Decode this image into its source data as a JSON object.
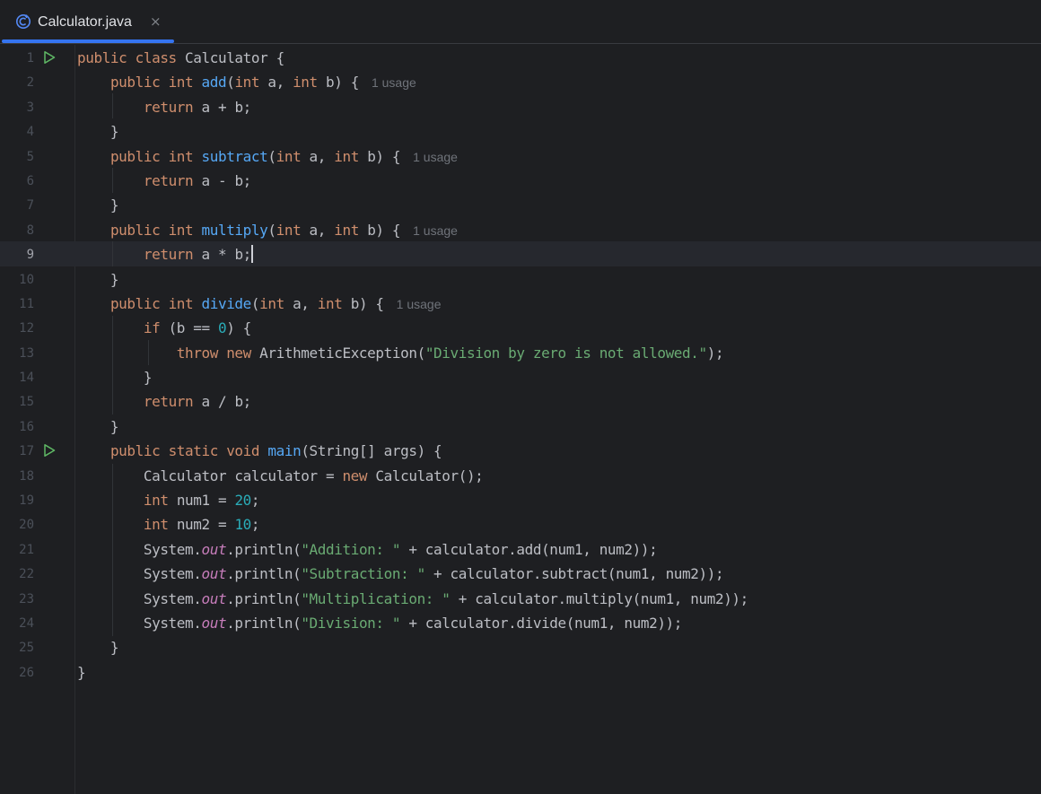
{
  "tab": {
    "label": "Calculator.java",
    "close": "×"
  },
  "editor": {
    "lines": [
      {
        "num": "1",
        "tokens": [
          [
            "kw",
            "public class "
          ],
          [
            "",
            "Calculator {"
          ]
        ]
      },
      {
        "num": "2",
        "tokens": [
          [
            "",
            "    "
          ],
          [
            "kw",
            "public int "
          ],
          [
            "fn",
            "add"
          ],
          [
            "",
            "("
          ],
          [
            "kw",
            "int "
          ],
          [
            "",
            "a, "
          ],
          [
            "kw",
            "int "
          ],
          [
            "",
            "b) {"
          ]
        ],
        "hint": "1 usage"
      },
      {
        "num": "3",
        "tokens": [
          [
            "",
            "        "
          ],
          [
            "kw",
            "return "
          ],
          [
            "",
            "a + b;"
          ]
        ]
      },
      {
        "num": "4",
        "tokens": [
          [
            "",
            "    }"
          ]
        ]
      },
      {
        "num": "5",
        "tokens": [
          [
            "",
            "    "
          ],
          [
            "kw",
            "public int "
          ],
          [
            "fn",
            "subtract"
          ],
          [
            "",
            "("
          ],
          [
            "kw",
            "int "
          ],
          [
            "",
            "a, "
          ],
          [
            "kw",
            "int "
          ],
          [
            "",
            "b) {"
          ]
        ],
        "hint": "1 usage"
      },
      {
        "num": "6",
        "tokens": [
          [
            "",
            "        "
          ],
          [
            "kw",
            "return "
          ],
          [
            "",
            "a - b;"
          ]
        ]
      },
      {
        "num": "7",
        "tokens": [
          [
            "",
            "    }"
          ]
        ]
      },
      {
        "num": "8",
        "tokens": [
          [
            "",
            "    "
          ],
          [
            "kw",
            "public int "
          ],
          [
            "fn",
            "multiply"
          ],
          [
            "",
            "("
          ],
          [
            "kw",
            "int "
          ],
          [
            "",
            "a, "
          ],
          [
            "kw",
            "int "
          ],
          [
            "",
            "b) {"
          ]
        ],
        "hint": "1 usage"
      },
      {
        "num": "9",
        "tokens": [
          [
            "",
            "        "
          ],
          [
            "kw",
            "return "
          ],
          [
            "",
            "a * b;"
          ]
        ],
        "caret": true
      },
      {
        "num": "10",
        "tokens": [
          [
            "",
            "    }"
          ]
        ]
      },
      {
        "num": "11",
        "tokens": [
          [
            "",
            "    "
          ],
          [
            "kw",
            "public int "
          ],
          [
            "fn",
            "divide"
          ],
          [
            "",
            "("
          ],
          [
            "kw",
            "int "
          ],
          [
            "",
            "a, "
          ],
          [
            "kw",
            "int "
          ],
          [
            "",
            "b) {"
          ]
        ],
        "hint": "1 usage"
      },
      {
        "num": "12",
        "tokens": [
          [
            "",
            "        "
          ],
          [
            "kw",
            "if "
          ],
          [
            "",
            "(b == "
          ],
          [
            "num",
            "0"
          ],
          [
            "",
            ") {"
          ]
        ]
      },
      {
        "num": "13",
        "tokens": [
          [
            "",
            "            "
          ],
          [
            "kw",
            "throw new "
          ],
          [
            "",
            "ArithmeticException("
          ],
          [
            "str",
            "\"Division by zero is not allowed.\""
          ],
          [
            "",
            ");"
          ]
        ]
      },
      {
        "num": "14",
        "tokens": [
          [
            "",
            "        }"
          ]
        ]
      },
      {
        "num": "15",
        "tokens": [
          [
            "",
            "        "
          ],
          [
            "kw",
            "return "
          ],
          [
            "",
            "a / b;"
          ]
        ]
      },
      {
        "num": "16",
        "tokens": [
          [
            "",
            "    }"
          ]
        ]
      },
      {
        "num": "17",
        "tokens": [
          [
            "",
            "    "
          ],
          [
            "kw",
            "public static void "
          ],
          [
            "fn",
            "main"
          ],
          [
            "",
            "(String[] args) {"
          ]
        ]
      },
      {
        "num": "18",
        "tokens": [
          [
            "",
            "        Calculator calculator = "
          ],
          [
            "kw",
            "new "
          ],
          [
            "",
            "Calculator();"
          ]
        ]
      },
      {
        "num": "19",
        "tokens": [
          [
            "",
            "        "
          ],
          [
            "kw",
            "int "
          ],
          [
            "",
            "num1 = "
          ],
          [
            "num",
            "20"
          ],
          [
            "",
            ";"
          ]
        ]
      },
      {
        "num": "20",
        "tokens": [
          [
            "",
            "        "
          ],
          [
            "kw",
            "int "
          ],
          [
            "",
            "num2 = "
          ],
          [
            "num",
            "10"
          ],
          [
            "",
            ";"
          ]
        ]
      },
      {
        "num": "21",
        "tokens": [
          [
            "",
            "        System."
          ],
          [
            "stat",
            "out"
          ],
          [
            "",
            ".println("
          ],
          [
            "str",
            "\"Addition: \""
          ],
          [
            "",
            " + calculator.add(num1, num2));"
          ]
        ]
      },
      {
        "num": "22",
        "tokens": [
          [
            "",
            "        System."
          ],
          [
            "stat",
            "out"
          ],
          [
            "",
            ".println("
          ],
          [
            "str",
            "\"Subtraction: \""
          ],
          [
            "",
            " + calculator.subtract(num1, num2));"
          ]
        ]
      },
      {
        "num": "23",
        "tokens": [
          [
            "",
            "        System."
          ],
          [
            "stat",
            "out"
          ],
          [
            "",
            ".println("
          ],
          [
            "str",
            "\"Multiplication: \""
          ],
          [
            "",
            " + calculator.multiply(num1, num2));"
          ]
        ]
      },
      {
        "num": "24",
        "tokens": [
          [
            "",
            "        System."
          ],
          [
            "stat",
            "out"
          ],
          [
            "",
            ".println("
          ],
          [
            "str",
            "\"Division: \""
          ],
          [
            "",
            " + calculator.divide(num1, num2));"
          ]
        ]
      },
      {
        "num": "25",
        "tokens": [
          [
            "",
            "    }"
          ]
        ]
      },
      {
        "num": "26",
        "tokens": [
          [
            "",
            "}"
          ]
        ]
      }
    ],
    "active_line": "9",
    "run_lines": [
      "1",
      "17"
    ]
  },
  "colors": {
    "background": "#1e1f22",
    "keyword": "#cf8e6d",
    "function": "#56a8f5",
    "string": "#6aab73",
    "number": "#2aacb8",
    "static_field": "#c77dbb",
    "run_icon": "#5fb865",
    "tab_accent": "#3574f0"
  },
  "icons": {
    "tab": "java-class-file-icon",
    "run": "run-gutter-icon"
  }
}
